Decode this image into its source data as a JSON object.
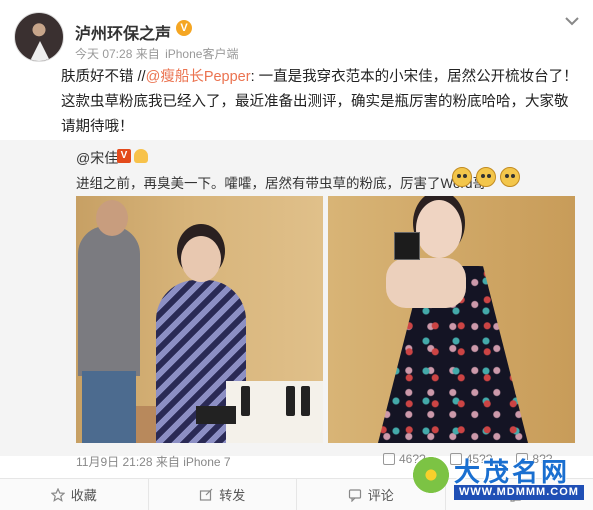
{
  "author": {
    "name": "泸州环保之声",
    "verified_badge": "V",
    "time": "今天 07:28",
    "from_label": "来自",
    "client": "iPhone客户端"
  },
  "post": {
    "text_prefix": "肤质好不错 //",
    "mention": "@瘦船长Pepper",
    "text_body": ": 一直是我穿衣范本的小宋佳，居然公开梳妆台了！这款虫草粉底我已经入了，最近准备出测评，确实是瓶厉害的粉底哈哈，大家敬请期待哦！"
  },
  "repost": {
    "author": "@宋佳",
    "vip_badge": "V",
    "text": "进组之前，再臭美一下。嚯嚯，居然有带虫草的粉底，厉害了Word哥~",
    "photos": [
      {
        "label": "makeup-artist-photo"
      },
      {
        "label": "dress-compact-photo"
      }
    ]
  },
  "footer_meta": {
    "date": "11月9日 21:28",
    "from_label": "来自",
    "client": "iPhone 7"
  },
  "stats": {
    "repost_count": "46??",
    "comment_count": "45??",
    "like_count": "8??"
  },
  "actions": [
    {
      "label": "收藏",
      "icon": "star-icon"
    },
    {
      "label": "转发",
      "icon": "share-icon"
    },
    {
      "label": "评论",
      "icon": "comment-icon"
    },
    {
      "label": "",
      "icon": "like-icon"
    }
  ],
  "watermark": {
    "title": "大茂名网",
    "url": "WWW.MDMMM.COM"
  },
  "colors": {
    "mention": "#eb7350",
    "repost_bg": "#f4f4f4",
    "watermark_blue": "#1a6fd0"
  }
}
